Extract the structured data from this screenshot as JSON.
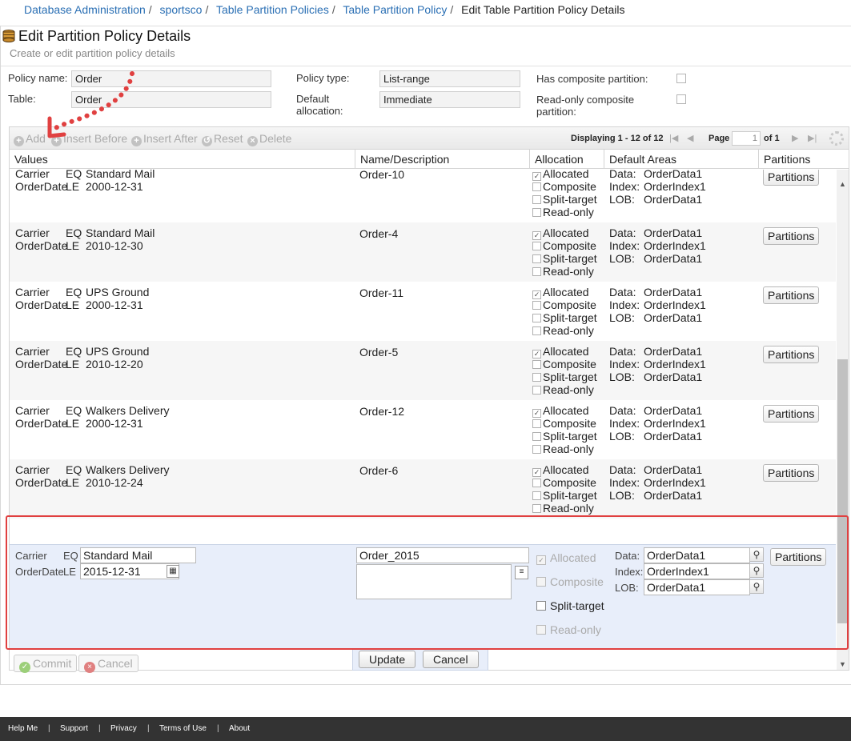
{
  "breadcrumb": [
    {
      "label": "Database Administration"
    },
    {
      "label": "sportsco"
    },
    {
      "label": "Table Partition Policies"
    },
    {
      "label": "Table Partition Policy"
    },
    {
      "label": "Edit Table Partition Policy Details"
    }
  ],
  "page": {
    "title": "Edit Partition Policy Details",
    "subtitle": "Create or edit partition policy details"
  },
  "form": {
    "policy_name_label": "Policy name:",
    "policy_name": "Order",
    "table_label": "Table:",
    "table": "Order",
    "policy_type_label": "Policy type:",
    "policy_type": "List-range",
    "default_allocation_label_1": "Default",
    "default_allocation_label_2": "allocation:",
    "default_allocation": "Immediate",
    "has_composite_label": "Has composite partition:",
    "readonly_composite_label_1": "Read-only composite",
    "readonly_composite_label_2": "partition:"
  },
  "toolbar": {
    "add": "Add",
    "insert_before": "Insert Before",
    "insert_after": "Insert After",
    "reset": "Reset",
    "delete": "Delete",
    "displaying": "Displaying 1 - 12 of 12",
    "page_label": "Page",
    "page_number": "1",
    "of_pages": "of 1"
  },
  "columns": {
    "values": "Values",
    "name": "Name/Description",
    "allocation": "Allocation",
    "default_areas": "Default Areas",
    "partitions": "Partitions"
  },
  "labels": {
    "allocated": "Allocated",
    "composite": "Composite",
    "split_target": "Split-target",
    "read_only": "Read-only",
    "data": "Data:",
    "index": "Index:",
    "lob": "LOB:",
    "partitions_btn": "Partitions",
    "field1": "Carrier",
    "field2": "OrderDate",
    "op1": "EQ",
    "op2": "LE"
  },
  "rows": [
    {
      "v1": "Standard Mail",
      "v2": "2000-12-31",
      "name": "Order-10",
      "data": "OrderData1",
      "index": "OrderIndex1",
      "lob": "OrderData1"
    },
    {
      "v1": "Standard Mail",
      "v2": "2010-12-30",
      "name": "Order-4",
      "data": "OrderData1",
      "index": "OrderIndex1",
      "lob": "OrderData1"
    },
    {
      "v1": "UPS Ground",
      "v2": "2000-12-31",
      "name": "Order-11",
      "data": "OrderData1",
      "index": "OrderIndex1",
      "lob": "OrderData1"
    },
    {
      "v1": "UPS Ground",
      "v2": "2010-12-20",
      "name": "Order-5",
      "data": "OrderData1",
      "index": "OrderIndex1",
      "lob": "OrderData1"
    },
    {
      "v1": "Walkers Delivery",
      "v2": "2000-12-31",
      "name": "Order-12",
      "data": "OrderData1",
      "index": "OrderIndex1",
      "lob": "OrderData1"
    },
    {
      "v1": "Walkers Delivery",
      "v2": "2010-12-24",
      "name": "Order-6",
      "data": "OrderData1",
      "index": "OrderIndex1",
      "lob": "OrderData1"
    }
  ],
  "edit": {
    "field1": "Carrier",
    "op1": "EQ",
    "value1": "Standard Mail",
    "field2": "OrderDate",
    "op2": "LE",
    "value2": "2015-12-31",
    "name": "Order_2015",
    "description": "",
    "allocated": "Allocated",
    "composite": "Composite",
    "split_target": "Split-target",
    "read_only": "Read-only",
    "data_label": "Data:",
    "data": "OrderData1",
    "index_label": "Index:",
    "index": "OrderIndex1",
    "lob_label": "LOB:",
    "lob": "OrderData1",
    "partitions": "Partitions",
    "update": "Update",
    "cancel": "Cancel"
  },
  "actions": {
    "commit": "Commit",
    "cancel": "Cancel"
  },
  "footer": {
    "help": "Help Me",
    "support": "Support",
    "privacy": "Privacy",
    "terms": "Terms of Use",
    "about": "About"
  },
  "colors": {
    "link": "#2a6fb4",
    "annotation_red": "#e04040",
    "edit_row_bg": "#e8eefa",
    "footer_bg": "#333333"
  },
  "icons": {
    "title": "database-icon",
    "add": "plus-circle-icon",
    "reset": "reset-icon",
    "delete": "x-circle-icon",
    "lookup": "magnifier-icon",
    "calendar": "calendar-icon",
    "commit": "check-circle-icon",
    "cancel": "x-circle-icon"
  }
}
